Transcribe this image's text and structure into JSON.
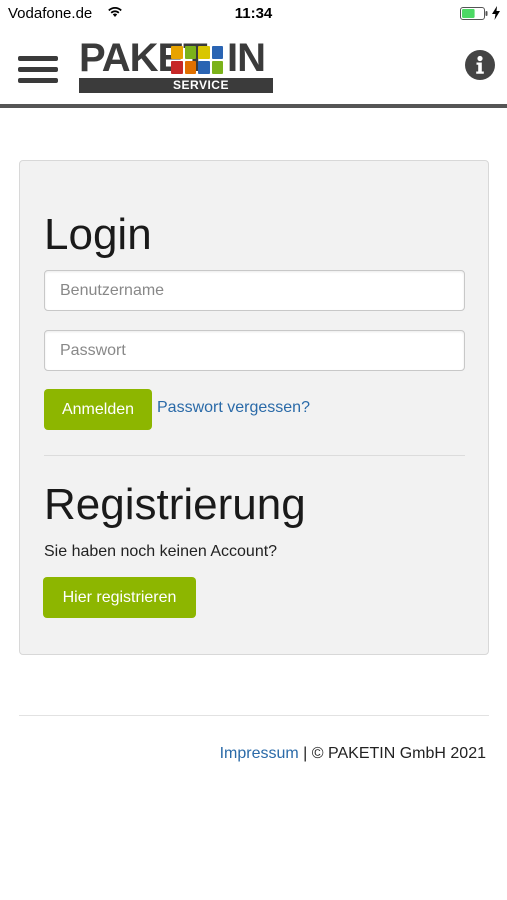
{
  "status_bar": {
    "carrier": "Vodafone.de",
    "time": "11:34",
    "wifi_icon": "wifi-icon",
    "battery_icon": "battery-icon",
    "battery_level": 0.6
  },
  "header": {
    "menu_icon": "hamburger-menu-icon",
    "logo": {
      "word_left": "PAKET",
      "word_right": "IN",
      "subtitle": "SERVICE",
      "grid_colors": [
        "#e8a300",
        "#7bb21a",
        "#d9c600",
        "#2a64b3",
        "#c62828",
        "#e07000",
        "#2a64b3",
        "#7bb21a"
      ]
    },
    "info_icon": "info-icon"
  },
  "login": {
    "title": "Login",
    "username_placeholder": "Benutzername",
    "password_placeholder": "Passwort",
    "submit_label": "Anmelden",
    "forgot_link": "Passwort vergessen?"
  },
  "register": {
    "title": "Registrierung",
    "prompt": "Sie haben noch keinen Account?",
    "button_label": "Hier registrieren"
  },
  "footer": {
    "impressum_link": "Impressum",
    "separator": "|",
    "copyright": "© PAKETIN GmbH 2021"
  },
  "colors": {
    "accent_green": "#8db600",
    "link_blue": "#2a6aa8",
    "card_bg": "#f2f2f2"
  }
}
